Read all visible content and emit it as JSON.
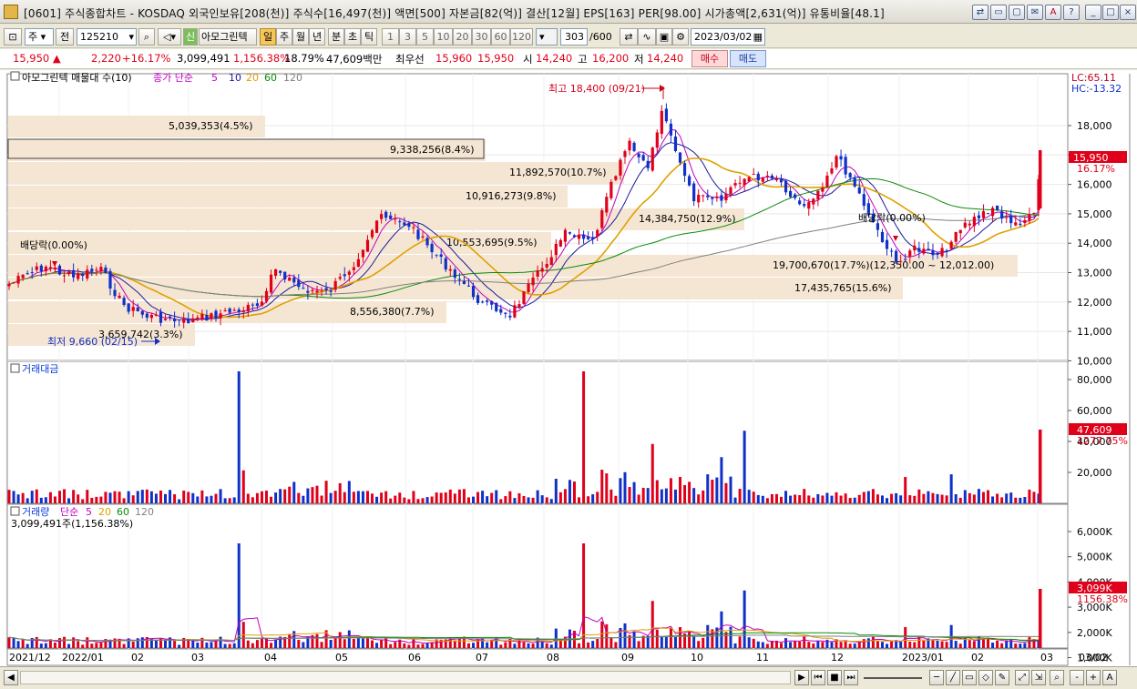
{
  "window": {
    "title": "[0601] 주식종합차트 - KOSDAQ 외국인보유[208(천)] 주식수[16,497(천)] 액면[500] 자본금[82(억)] 결산[12월] EPS[163] PER[98.00] 시가총액[2,631(억)] 유통비율[48.1]",
    "buttons": [
      "⇄",
      "▭",
      "▢",
      "✉",
      "A",
      "?",
      "_",
      "□",
      "×"
    ]
  },
  "toolbar": {
    "period": "주",
    "prev": "전",
    "code": "125210",
    "name": "아모그린텍",
    "new_badge": "신",
    "intervals": [
      "일",
      "주",
      "월",
      "년",
      "분",
      "초",
      "틱"
    ],
    "minutes": [
      "1",
      "3",
      "5",
      "10",
      "20",
      "30",
      "60",
      "120"
    ],
    "count": "303",
    "count_total": "/600",
    "date": "2023/03/02"
  },
  "price_strip": {
    "price": "15,950",
    "change": "2,220",
    "change_pct": "+16.17%",
    "volume": "3,099,491",
    "volume_pct": "1,156.38%",
    "turnover": "18.79%",
    "amount": "47,609백만",
    "best_label": "최우선",
    "ask": "15,960",
    "bid": "15,950",
    "open_label": "시",
    "open": "14,240",
    "high_label": "고",
    "high": "16,200",
    "low_label": "저",
    "low": "14,240",
    "buy": "매수",
    "sell": "매도"
  },
  "price_panel": {
    "title": "아모그린텍 매물대 수(10)",
    "legend_prefix": "종가 단순",
    "ma": [
      {
        "label": "5",
        "color": "#c000c0"
      },
      {
        "label": "10",
        "color": "#1a1aa0"
      },
      {
        "label": "20",
        "color": "#e0a000"
      },
      {
        "label": "60",
        "color": "#0a8a0a"
      },
      {
        "label": "120",
        "color": "#808080"
      }
    ],
    "lc": "LC:65.11",
    "hc": "HC:-13.32",
    "yticks": [
      "18,000",
      "17,000",
      "16,000",
      "15,000",
      "14,000",
      "13,000",
      "12,000",
      "11,000",
      "10,000"
    ],
    "last_price": "15,950",
    "last_pct": "16.17%",
    "high_note": "최고 18,400 (09/21)",
    "low_note": "최저 9,660 (02/15)",
    "ex_div_1": "배당락(0.00%)",
    "ex_div_2": "배당락(0.00%)",
    "volume_profile": [
      {
        "label": "5,039,353(4.5%)"
      },
      {
        "label": "9,338,256(8.4%)"
      },
      {
        "label": "11,892,570(10.7%)"
      },
      {
        "label": "10,916,273(9.8%)"
      },
      {
        "label": "14,384,750(12.9%)"
      },
      {
        "label": "10,553,695(9.5%)"
      },
      {
        "label": "19,700,670(17.7%)(12,350.00 ~ 12,012.00)"
      },
      {
        "label": "17,435,765(15.6%)"
      },
      {
        "label": "8,556,380(7.7%)"
      },
      {
        "label": "3,659,742(3.3%)"
      }
    ]
  },
  "amount_panel": {
    "title": "거래대금",
    "yticks": [
      "80,000",
      "60,000",
      "40,000",
      "20,000"
    ],
    "last": "47,609",
    "last_pct": "1277.75%"
  },
  "volume_panel": {
    "title_prefix": "거래량",
    "legend_prefix": "단순",
    "ma": [
      "5",
      "20",
      "60",
      "120"
    ],
    "current": "3,099,491주(1,156.38%)",
    "yticks": [
      "6,000K",
      "5,000K",
      "4,000K",
      "3,000K",
      "2,000K",
      "1,000K"
    ],
    "last": "3,099K",
    "last_pct": "1156.38%"
  },
  "xaxis": {
    "labels": [
      "2021/12",
      "2022/01",
      "02",
      "03",
      "04",
      "05",
      "06",
      "07",
      "08",
      "09",
      "10",
      "11",
      "12",
      "2023/01",
      "02",
      "03",
      "03/02"
    ]
  },
  "statusbar": {
    "nav": [
      "◀",
      "▶",
      "⏮",
      "■",
      "⏭"
    ],
    "tools": [
      "─",
      "╱",
      "▭",
      "◇",
      "✎"
    ],
    "zoom": [
      "-",
      "+",
      "A"
    ]
  },
  "colors": {
    "up": "#e0001a",
    "down": "#1030c8",
    "profile": "#f5e6d3"
  }
}
